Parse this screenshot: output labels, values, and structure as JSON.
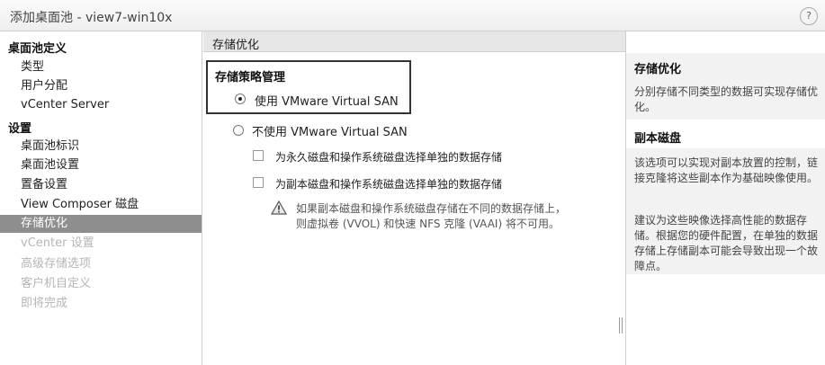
{
  "window": {
    "title": "添加桌面池 - view7-win10x",
    "help": "?"
  },
  "nav": {
    "section1": "桌面池定义",
    "items1": [
      "类型",
      "用户分配",
      "vCenter Server"
    ],
    "section2": "设置",
    "items2": [
      "桌面池标识",
      "桌面池设置",
      "置备设置",
      "View Composer 磁盘"
    ],
    "active": "存储优化",
    "disabled": [
      "vCenter 设置",
      "高级存储选项",
      "客户机自定义",
      "即将完成"
    ]
  },
  "main": {
    "header": "存储优化",
    "policy_label": "存储策略管理",
    "option_use": "使用 VMware Virtual SAN",
    "option_not_use": "不使用 VMware Virtual SAN",
    "check_persistent": "为永久磁盘和操作系统磁盘选择单独的数据存储",
    "check_replica": "为副本磁盘和操作系统磁盘选择单独的数据存储",
    "warning": "如果副本磁盘和操作系统磁盘存储在不同的数据存储上，则虚拟卷 (VVOL) 和快速 NFS 克隆 (VAAI) 将不可用。"
  },
  "help_panel": {
    "title1": "存储优化",
    "text1": "分别存储不同类型的数据可实现存储优化。",
    "title2": "副本磁盘",
    "text2": "该选项可以实现对副本放置的控制，链接克隆将这些副本作为基础映像使用。",
    "text3": "建议为这些映像选择高性能的数据存储。根据您的硬件配置，在单独的数据存储上存储副本可能会导致出现一个故障点。"
  }
}
